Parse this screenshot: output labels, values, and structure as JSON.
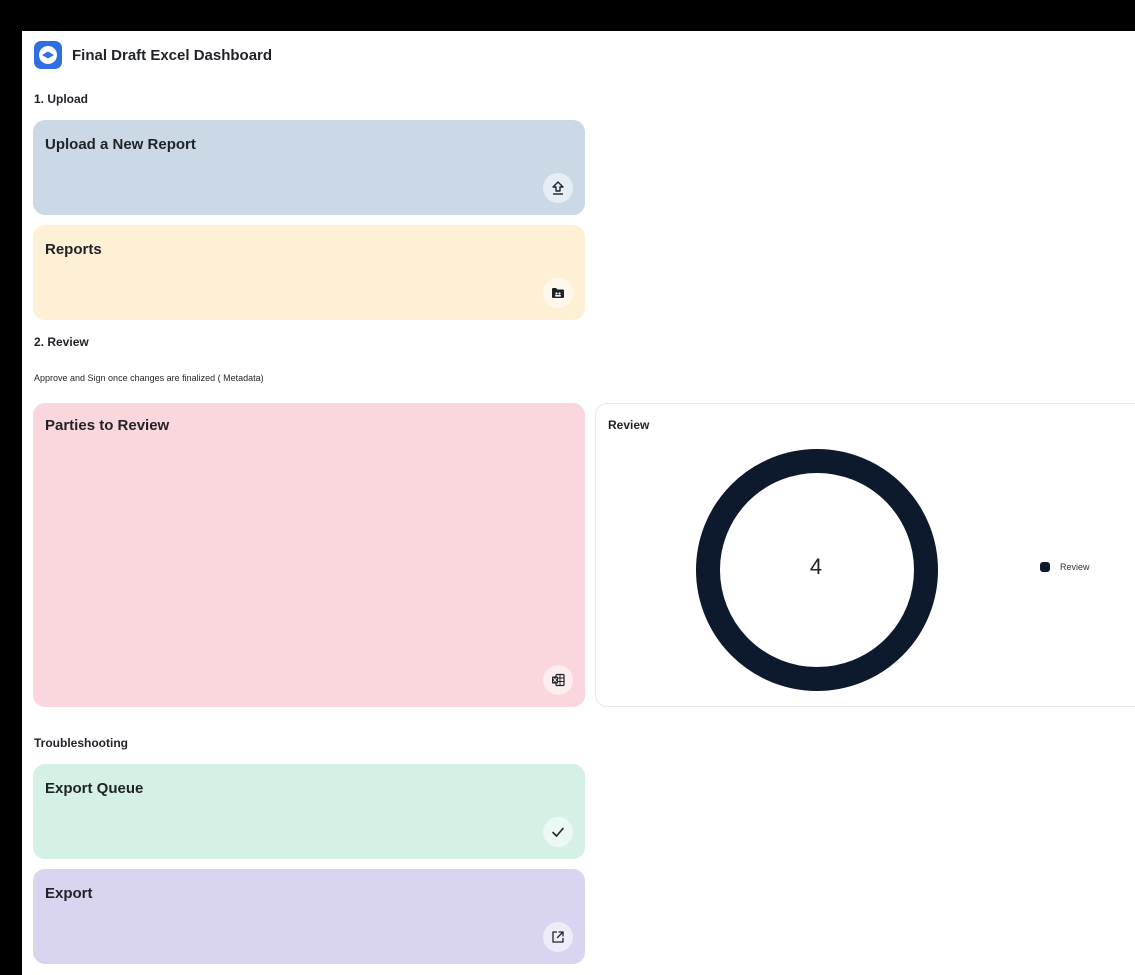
{
  "app": {
    "title": "Final Draft Excel Dashboard"
  },
  "sections": {
    "upload": {
      "label": "1. Upload"
    },
    "review": {
      "label": "2. Review",
      "description": "Approve and Sign once changes are finalized ( Metadata)"
    },
    "troubleshooting": {
      "label": "Troubleshooting"
    }
  },
  "cards": {
    "upload_report": {
      "title": "Upload a New Report",
      "icon": "upload-icon",
      "color": "#cbd8e6"
    },
    "reports": {
      "title": "Reports",
      "icon": "folder-icon",
      "color": "#fdf0d5"
    },
    "parties_to_review": {
      "title": "Parties to Review",
      "icon": "excel-icon",
      "color": "#f9d7dc"
    },
    "export_queue": {
      "title": "Export Queue",
      "icon": "checkmark-icon",
      "color": "#d5f0e4"
    },
    "export": {
      "title": "Export",
      "icon": "external-link-icon",
      "color": "#d9d5f0"
    }
  },
  "chart_data": {
    "type": "pie",
    "title": "Review",
    "categories": [
      "Review"
    ],
    "values": [
      4
    ],
    "center_label": "4",
    "legend_placement": "right",
    "colors": [
      "#0d1a2e"
    ]
  }
}
